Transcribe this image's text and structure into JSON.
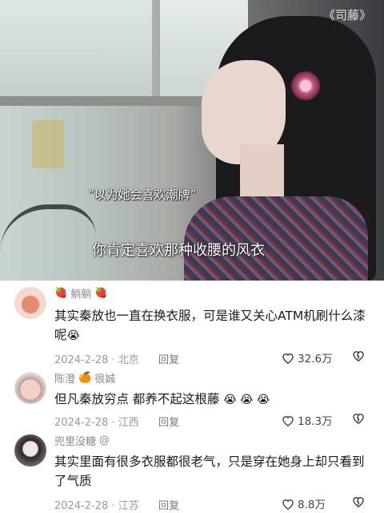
{
  "video": {
    "watermark": "《司藤》",
    "subtitle_top": "“以为她会喜欢潮牌”",
    "subtitle_main": "你肯定喜欢那种收腰的风衣"
  },
  "comments": [
    {
      "user": "躺躺",
      "badge_left": "🍓",
      "badge_right": "🍓",
      "text": "其实秦放也一直在换衣服，可是谁又关心ATM机刷什么漆呢",
      "emoji": "😭",
      "date": "2024-2-28",
      "location": "北京",
      "reply": "回复",
      "likes": "32.6万"
    },
    {
      "user": "陈澄",
      "badge_left": "",
      "badge_right": "🍊",
      "user_suffix": "很娍",
      "text": "但凡秦放穷点 都养不起这根藤",
      "emoji": "😭 😭 😭",
      "date": "2024-2-28",
      "location": "江西",
      "reply": "回复",
      "likes": "18.3万"
    },
    {
      "user": "兜里没糖",
      "user_suffix": "@",
      "text": "其实里面有很多衣服都很老气，只是穿在她身上却只看到了气质",
      "date": "2024-2-28",
      "location": "江苏",
      "reply": "回复",
      "likes": "8.8万"
    }
  ]
}
